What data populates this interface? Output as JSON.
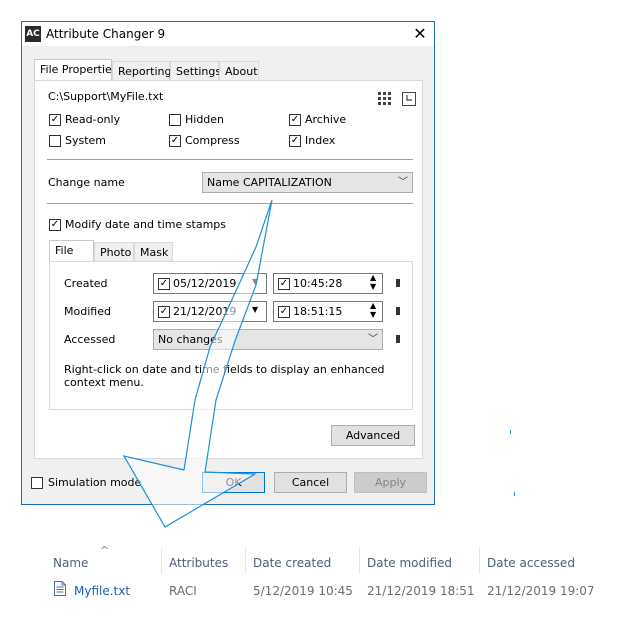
{
  "window": {
    "title": "Attribute Changer 9",
    "app_icon": "AC",
    "close_glyph": "✕"
  },
  "tabs": [
    {
      "label": "File Properties",
      "active": true
    },
    {
      "label": "Reporting",
      "active": false
    },
    {
      "label": "Settings",
      "active": false
    },
    {
      "label": "About",
      "active": false
    }
  ],
  "file_path": "C:\\Support\\MyFile.txt",
  "attributes": [
    {
      "label": "Read-only",
      "checked": true
    },
    {
      "label": "Hidden",
      "checked": false
    },
    {
      "label": "Archive",
      "checked": true
    },
    {
      "label": "System",
      "checked": false
    },
    {
      "label": "Compress",
      "checked": true
    },
    {
      "label": "Index",
      "checked": true
    }
  ],
  "change_name": {
    "label": "Change name",
    "value": "Name CAPITALIZATION"
  },
  "modify_dates": {
    "label": "Modify date and time stamps",
    "checked": true
  },
  "date_tabs": [
    {
      "label": "File",
      "active": true
    },
    {
      "label": "Photo",
      "active": false
    },
    {
      "label": "Mask",
      "active": false
    }
  ],
  "dates": {
    "created": {
      "label": "Created",
      "date": "05/12/2019",
      "time": "10:45:28"
    },
    "modified": {
      "label": "Modified",
      "date": "21/12/2019",
      "time": "18:51:15"
    },
    "accessed": {
      "label": "Accessed",
      "value": "No changes"
    }
  },
  "hint_text": "Right-click on date and time fields to display an enhanced context menu.",
  "buttons": {
    "advanced": "Advanced",
    "ok": "OK",
    "cancel": "Cancel",
    "apply": "Apply"
  },
  "simulation_mode": {
    "label": "Simulation mode",
    "checked": false
  },
  "explorer": {
    "columns": [
      "Name",
      "Attributes",
      "Date created",
      "Date modified",
      "Date accessed"
    ],
    "sort_glyph": "^",
    "row": {
      "name": "Myfile.txt",
      "attributes": "RACI",
      "date_created": "5/12/2019 10:45",
      "date_modified": "21/12/2019 18:51",
      "date_accessed": "21/12/2019 19:07"
    }
  },
  "colors": {
    "window_border": "#1c6fb6",
    "arrow_stroke": "#1e90d6",
    "link_blue": "#1a5fb4"
  }
}
